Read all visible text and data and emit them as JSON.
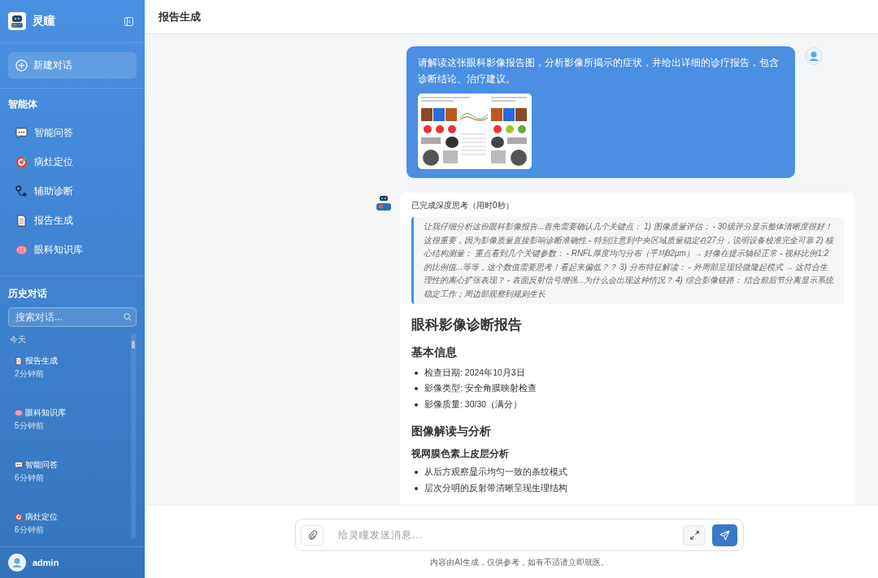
{
  "sidebar": {
    "app_name": "灵瞳",
    "new_chat": "新建对话",
    "agents_title": "智能体",
    "agents": [
      {
        "label": "智能问答",
        "kind": "qa"
      },
      {
        "label": "病灶定位",
        "kind": "locate"
      },
      {
        "label": "辅助诊断",
        "kind": "diagnosis"
      },
      {
        "label": "报告生成",
        "kind": "report"
      },
      {
        "label": "眼科知识库",
        "kind": "knowledge"
      }
    ],
    "history_title": "历史对话",
    "search": {
      "placeholder": "搜索对话..."
    },
    "group_label": "今天",
    "history": [
      {
        "title": "报告生成",
        "time": "2分钟前",
        "kind": "report"
      },
      {
        "title": "眼科知识库",
        "time": "5分钟前",
        "kind": "knowledge"
      },
      {
        "title": "智能问答",
        "time": "6分钟前",
        "kind": "qa"
      },
      {
        "title": "病灶定位",
        "time": "6分钟前",
        "kind": "locate"
      }
    ],
    "user": "admin"
  },
  "header": {
    "title": "报告生成"
  },
  "messages": [
    {
      "kind": "user",
      "text": "请解读这张眼科影像报告图，分析影像所揭示的症状，并给出详细的诊疗报告，包含诊断结论、治疗建议。"
    },
    {
      "kind": "assistant",
      "thinking_label": "已完成深度思考（用时0秒）",
      "thinking": "让我仔细分析这份眼科影像报告...首先需要确认几个关键点： 1) 图像质量评估： - 30级评分显示整体清晰度很好！这很重要，因为影像质量直接影响诊断准确性 - 特别注意到中央区域质量稳定在27分，说明设备校准完全可靠 2) 核心结构测量： 重点看到几个关键参数： - RNFL厚度均匀分布（平均82μm）→ 好像在提示轴径正常 - 视杯比例1:2的比例值...等等，这个数值需要思考！看起来偏低？？ 3) 分布特征解读： - 外周部呈现轻微隆起模式 → 这符合生理性的离心扩张表现？ - 表面反射信号增强...为什么会出现这种情况？ 4) 综合影像链路： 结合前后节分离显示系统稳定工作；周边部观察到规则生长",
      "blocks": [
        {
          "kind": "h1",
          "text": "眼科影像诊断报告"
        },
        {
          "kind": "h2",
          "text": "基本信息"
        },
        {
          "kind": "list",
          "items": [
            "检查日期: 2024年10月3日",
            "影像类型: 安全角膜映射检查",
            "影像质量: 30/30（满分）"
          ]
        },
        {
          "kind": "h2",
          "text": "图像解读与分析"
        },
        {
          "kind": "h3",
          "text": "视网膜色素上皮层分析"
        },
        {
          "kind": "list",
          "items": [
            "从后方观察显示均匀一致的条纹模式",
            "层次分明的反射带清晰呈现生理结构"
          ]
        }
      ]
    }
  ],
  "composer": {
    "placeholder": "给灵瞳发送消息...",
    "disclaimer": "内容由AI生成，仅供参考，如有不适请立即就医。"
  }
}
